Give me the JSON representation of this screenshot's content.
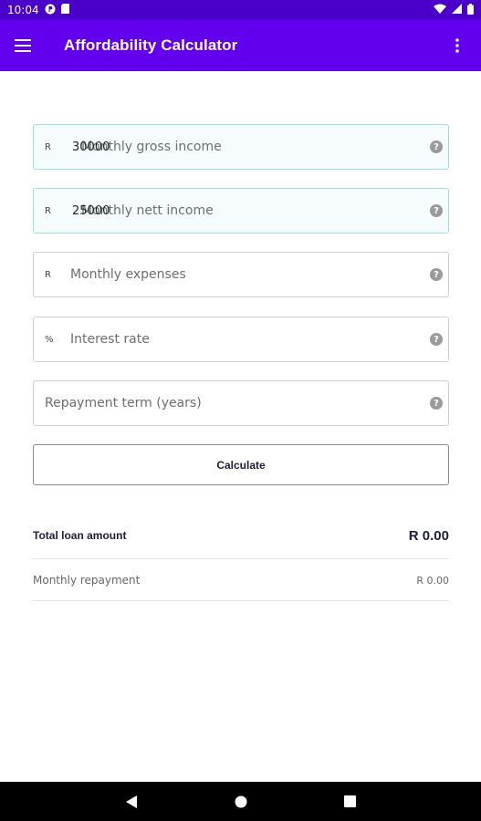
{
  "status_bar": {
    "time": "10:04"
  },
  "app_bar": {
    "title": "Affordability Calculator"
  },
  "fields": [
    {
      "prefix": "R",
      "value": "30000",
      "label": "Monthly gross income"
    },
    {
      "prefix": "R",
      "value": "25000",
      "label": "Monthly nett income"
    },
    {
      "prefix": "R",
      "value": "",
      "label": "Monthly expenses"
    },
    {
      "prefix": "%",
      "value": "",
      "label": "Interest rate"
    },
    {
      "prefix": "",
      "value": "",
      "label": "Repayment term (years)"
    }
  ],
  "calculate_label": "Calculate",
  "results": {
    "total_label": "Total loan amount",
    "total_value": "R 0.00",
    "monthly_label": "Monthly repayment",
    "monthly_value": "R 0.00"
  },
  "colors": {
    "app_bar": "#6200ee",
    "status_bar": "#4a00c8",
    "filled_border": "#9fdde5"
  }
}
